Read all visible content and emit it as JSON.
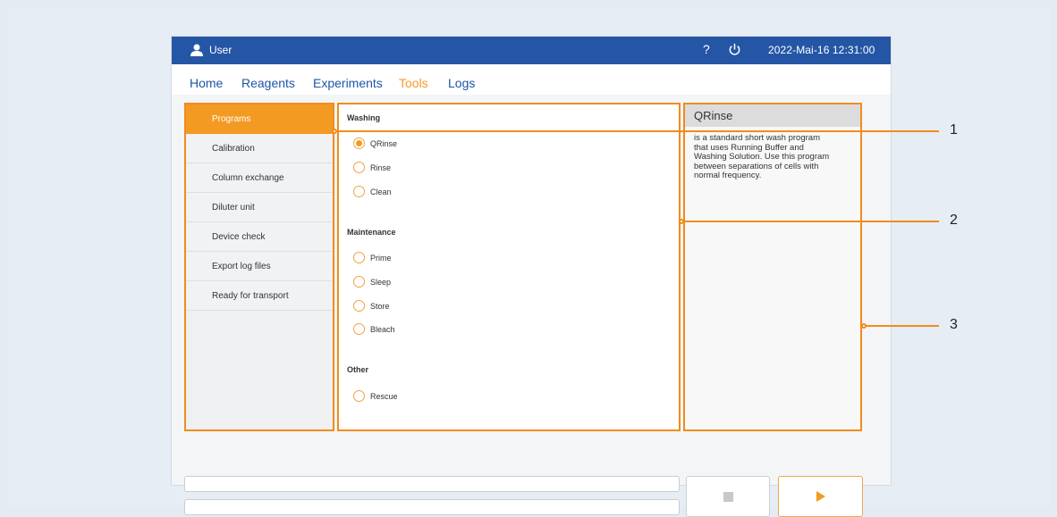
{
  "topbar": {
    "user_label": "User",
    "help_label": "?",
    "datetime": "2022-Mai-16  12:31:00"
  },
  "nav": {
    "tabs": [
      "Home",
      "Reagents",
      "Experiments",
      "Tools",
      "Logs"
    ],
    "active_tab": "Tools"
  },
  "menu": {
    "items": [
      "Programs",
      "Calibration",
      "Column exchange",
      "Diluter unit",
      "Device check",
      "Export log files",
      "Ready for transport"
    ],
    "active_item": "Programs"
  },
  "programs": {
    "groups": [
      {
        "title": "Washing",
        "options": [
          "QRinse",
          "Rinse",
          "Clean"
        ]
      },
      {
        "title": "Maintenance",
        "options": [
          "Prime",
          "Sleep",
          "Store",
          "Bleach"
        ]
      },
      {
        "title": "Other",
        "options": [
          "Rescue"
        ]
      }
    ],
    "selected": "QRinse"
  },
  "description": {
    "title": "QRinse",
    "text": "is a standard short wash program that uses Running Buffer and Washing Solution. Use this program between separations of cells with normal frequency."
  },
  "callouts": [
    "1",
    "2",
    "3"
  ],
  "colors": {
    "topbar": "#2556a6",
    "accent": "#f39a23",
    "nav_link": "#1d55a7"
  }
}
